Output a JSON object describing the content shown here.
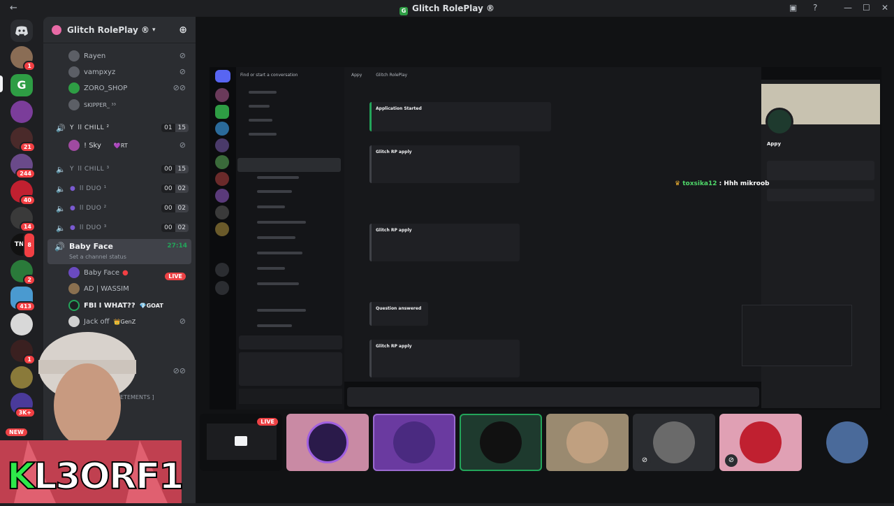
{
  "window": {
    "title": "Glitch RolePlay ®"
  },
  "server": {
    "name": "Glitch RolePlay ®"
  },
  "guild_badges": [
    "1",
    "21",
    "244",
    "40",
    "14",
    "8",
    "2",
    "413",
    "1",
    "3K+"
  ],
  "guild_new_label": "NEW",
  "voice_users_top": [
    "Rayen",
    "vampxyz",
    "ZORO_SHOP",
    "SKIPPER_ ³³"
  ],
  "channels": [
    {
      "name": "ll CHILL ²",
      "count": "01",
      "limit": "15"
    },
    {
      "name": "ll CHILL ³",
      "count": "00",
      "limit": "15"
    },
    {
      "name": "ll DUO ¹",
      "count": "00",
      "limit": "02"
    },
    {
      "name": "ll DUO ²",
      "count": "00",
      "limit": "02"
    },
    {
      "name": "ll DUO ³",
      "count": "00",
      "limit": "02"
    }
  ],
  "chill_user": {
    "name": "! Sky",
    "tag": "💜RT"
  },
  "active_channel": {
    "name": "Baby Face",
    "timer": "27:14",
    "status": "Set a channel status"
  },
  "baby_face_users": [
    {
      "name": "Baby Face",
      "live": "LIVE"
    },
    {
      "name": "AD | WASSIM",
      "tag": ""
    },
    {
      "name": "FBI I WHAT??",
      "tag": "💎GOAT"
    },
    {
      "name": "Jack off",
      "tag": "👑GenZ"
    }
  ],
  "announcements_label": "ETEMENTS ]",
  "stream_chat": {
    "user": "toxsika12",
    "message": " : Hhh mikroob"
  },
  "stream_inner": {
    "bot_name": "Appy",
    "embed_titles": [
      "Application Started",
      "Glitch RP apply",
      "Glitch RP apply",
      "Question answered",
      "Glitch RP apply"
    ],
    "search_placeholder": "Find or start a conversation",
    "channel_header": "Glitch RolePlay"
  },
  "tile_live": "LIVE",
  "brand_text": {
    "first": "K",
    "rest": "L3ORF1"
  },
  "colors": {
    "accent_green": "#23a55a",
    "live_red": "#ed4245",
    "brand_green": "#2ee84a"
  }
}
